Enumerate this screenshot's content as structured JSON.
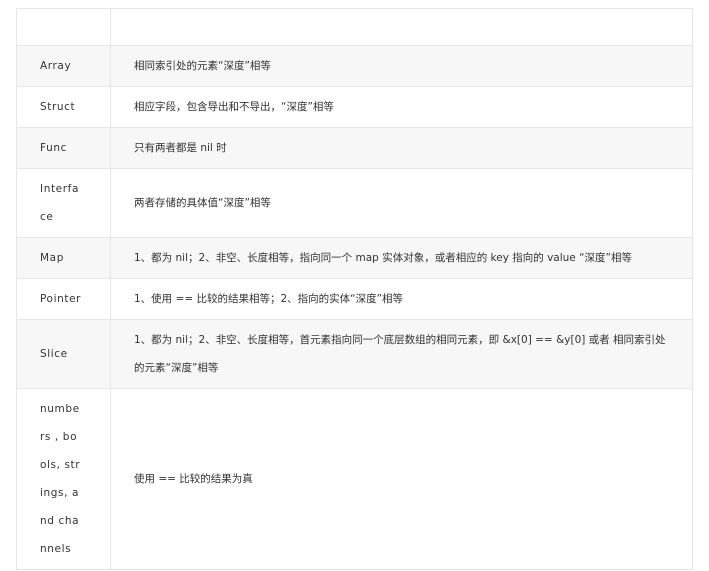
{
  "table": {
    "header": [
      "",
      ""
    ],
    "rows": [
      {
        "type": "Array",
        "rule": "相同索引处的元素“深度”相等"
      },
      {
        "type": "Struct",
        "rule": "相应字段，包含导出和不导出，“深度”相等"
      },
      {
        "type": "Func",
        "rule": "只有两者都是 nil 时"
      },
      {
        "type": "Interface",
        "rule": "两者存储的具体值“深度”相等"
      },
      {
        "type": "Map",
        "rule": "1、都为 nil；2、非空、长度相等，指向同一个 map 实体对象，或者相应的 key 指向的 value “深度”相等"
      },
      {
        "type": "Pointer",
        "rule": "1、使用 == 比较的结果相等；2、指向的实体“深度”相等"
      },
      {
        "type": "Slice",
        "rule": "1、都为 nil；2、非空、长度相等，首元素指向同一个底层数组的相同元素，即 &x[0] == &y[0] 或者 相同索引处的元素“深度”相等"
      },
      {
        "type": "numbers , bools, strings, and channels",
        "rule": "使用 == 比较的结果为真"
      }
    ]
  }
}
